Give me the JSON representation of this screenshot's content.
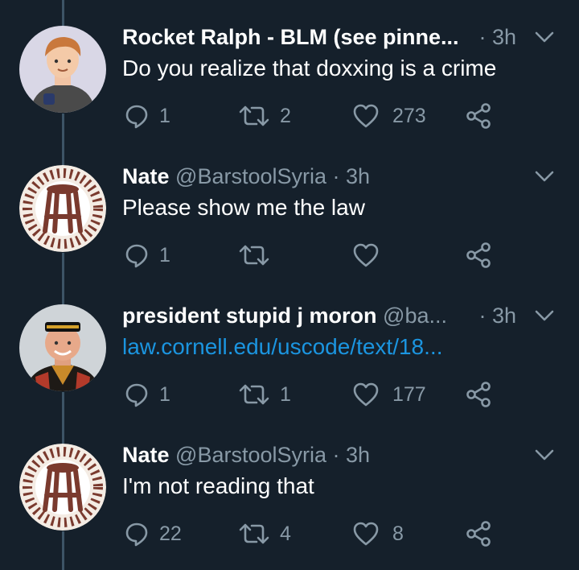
{
  "tweets": [
    {
      "name": "Rocket Ralph - BLM (see pinne...",
      "handle": "",
      "time": "· 3h",
      "text": "Do you realize that doxxing is a crime",
      "replies": "1",
      "retweets": "2",
      "likes": "273"
    },
    {
      "name": "Nate",
      "handle": "@BarstoolSyria",
      "time": "· 3h",
      "text": "Please show me the law",
      "replies": "1",
      "retweets": "",
      "likes": ""
    },
    {
      "name": "president stupid j moron",
      "handle": "@ba...",
      "time": "· 3h",
      "text": "law.cornell.edu/uscode/text/18...",
      "replies": "1",
      "retweets": "1",
      "likes": "177"
    },
    {
      "name": "Nate",
      "handle": "@BarstoolSyria",
      "time": "· 3h",
      "text": "I'm not reading that",
      "replies": "22",
      "retweets": "4",
      "likes": "8"
    }
  ],
  "colors": {
    "background": "#15202b",
    "secondary_text": "#8899a6",
    "link": "#1b95e0",
    "thread_line": "#3d5466"
  },
  "icons": [
    "reply-icon",
    "retweet-icon",
    "like-icon",
    "share-icon",
    "chevron-down-icon"
  ]
}
